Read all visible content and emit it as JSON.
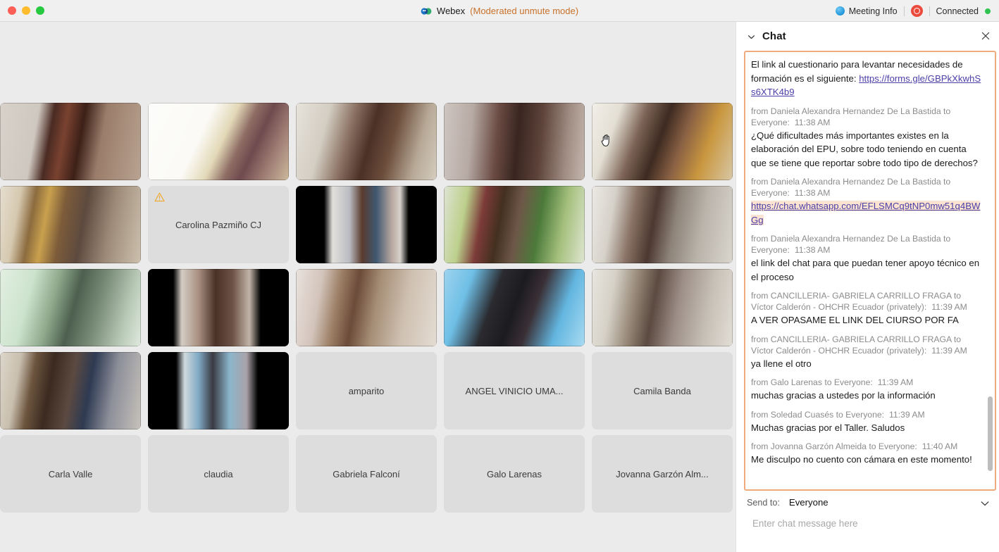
{
  "titlebar": {
    "traffic_lights": [
      "close",
      "minimize",
      "maximize"
    ],
    "app_name": "Webex",
    "mode_label": "(Moderated unmute mode)",
    "meeting_info_label": "Meeting Info",
    "recording_icon": "record-icon",
    "connection_label": "Connected",
    "colors": {
      "mode_text": "#c8712a",
      "connected_dot": "#2ec44f",
      "record_badge": "#ec4a3c"
    }
  },
  "stage": {
    "participants": [
      {
        "name": "",
        "has_video": true,
        "row": 1,
        "col": 1
      },
      {
        "name": "",
        "has_video": true,
        "row": 1,
        "col": 2
      },
      {
        "name": "",
        "has_video": true,
        "row": 1,
        "col": 3
      },
      {
        "name": "",
        "has_video": true,
        "row": 1,
        "col": 4
      },
      {
        "name": "",
        "has_video": true,
        "row": 1,
        "col": 5
      },
      {
        "name": "",
        "has_video": true,
        "row": 2,
        "col": 1
      },
      {
        "name": "Carolina Pazmiño CJ",
        "has_video": false,
        "warning": true,
        "row": 2,
        "col": 2
      },
      {
        "name": "",
        "has_video": true,
        "row": 2,
        "col": 3
      },
      {
        "name": "",
        "has_video": true,
        "row": 2,
        "col": 4
      },
      {
        "name": "",
        "has_video": true,
        "row": 2,
        "col": 5
      },
      {
        "name": "",
        "has_video": true,
        "row": 3,
        "col": 1
      },
      {
        "name": "",
        "has_video": true,
        "row": 3,
        "col": 2
      },
      {
        "name": "",
        "has_video": true,
        "row": 3,
        "col": 3
      },
      {
        "name": "",
        "has_video": true,
        "row": 3,
        "col": 4
      },
      {
        "name": "",
        "has_video": true,
        "row": 3,
        "col": 5
      },
      {
        "name": "",
        "has_video": true,
        "row": 4,
        "col": 1
      },
      {
        "name": "",
        "has_video": true,
        "row": 4,
        "col": 2
      },
      {
        "name": "amparito",
        "has_video": false,
        "row": 4,
        "col": 3
      },
      {
        "name": "ANGEL VINICIO UMA...",
        "has_video": false,
        "row": 4,
        "col": 4
      },
      {
        "name": "Camila Banda",
        "has_video": false,
        "row": 4,
        "col": 5
      },
      {
        "name": "Carla Valle",
        "has_video": false,
        "row": 5,
        "col": 1
      },
      {
        "name": "claudia",
        "has_video": false,
        "row": 5,
        "col": 2
      },
      {
        "name": "Gabriela Falconí",
        "has_video": false,
        "row": 5,
        "col": 3
      },
      {
        "name": "Galo Larenas",
        "has_video": false,
        "row": 5,
        "col": 4
      },
      {
        "name": "Jovanna Garzón Alm...",
        "has_video": false,
        "row": 5,
        "col": 5
      }
    ],
    "cursor": "hand-grab-cursor"
  },
  "chat": {
    "title": "Chat",
    "collapse_icon": "chevron-down-icon",
    "close_icon": "close-icon",
    "messages": [
      {
        "meta": "",
        "time": "",
        "text_before": "El link al cuestionario para levantar necesidades de formación es el siguiente: ",
        "link": "https://forms.gle/GBPkXkwhSs6XTK4b9",
        "link_highlight": false,
        "text_after": ""
      },
      {
        "meta": "from Daniela Alexandra Hernandez De La Bastida to Everyone:",
        "time": "11:38  AM",
        "text_before": "¿Qué dificultades más importantes existes en la elaboración del EPU, sobre todo teniendo en cuenta que se tiene que reportar sobre todo tipo de derechos?",
        "link": "",
        "link_highlight": false,
        "text_after": ""
      },
      {
        "meta": "from Daniela Alexandra Hernandez De La Bastida to Everyone:",
        "time": "11:38  AM",
        "text_before": "",
        "link": "https://chat.whatsapp.com/EFLSMCq9tNP0mw51q4BWGg",
        "link_highlight": true,
        "text_after": ""
      },
      {
        "meta": "from Daniela Alexandra Hernandez De La Bastida to Everyone:",
        "time": "11:38  AM",
        "text_before": "el link del chat para que puedan tener apoyo técnico en el proceso",
        "link": "",
        "link_highlight": false,
        "text_after": ""
      },
      {
        "meta": "from CANCILLERIA- GABRIELA CARRILLO FRAGA to Víctor Calderón - OHCHR Ecuador (privately):",
        "time": "11:39  AM",
        "text_before": "A VER OPASAME EL LINK DEL CIURSO POR FA",
        "link": "",
        "link_highlight": false,
        "text_after": ""
      },
      {
        "meta": "from CANCILLERIA- GABRIELA CARRILLO FRAGA to Víctor Calderón - OHCHR Ecuador (privately):",
        "time": "11:39  AM",
        "text_before": "ya llene el otro",
        "link": "",
        "link_highlight": false,
        "text_after": ""
      },
      {
        "meta": "from Galo Larenas to Everyone:",
        "time": "11:39  AM",
        "text_before": "muchas gracias a ustedes por la información",
        "link": "",
        "link_highlight": false,
        "text_after": ""
      },
      {
        "meta": "from Soledad Cuasés to Everyone:",
        "time": "11:39  AM",
        "text_before": "Muchas gracias por el Taller. Saludos",
        "link": "",
        "link_highlight": false,
        "text_after": ""
      },
      {
        "meta": "from Jovanna Garzón Almeida to Everyone:",
        "time": "11:40  AM",
        "text_before": "Me disculpo no cuento con cámara en este momento!",
        "link": "",
        "link_highlight": false,
        "text_after": ""
      }
    ],
    "send_to_label": "Send to:",
    "send_to_value": "Everyone",
    "send_to_chevron_icon": "chevron-down-icon",
    "input_placeholder": "Enter chat message here",
    "accent_border": "#f0ab7c",
    "link_color": "#4b3fa8"
  }
}
